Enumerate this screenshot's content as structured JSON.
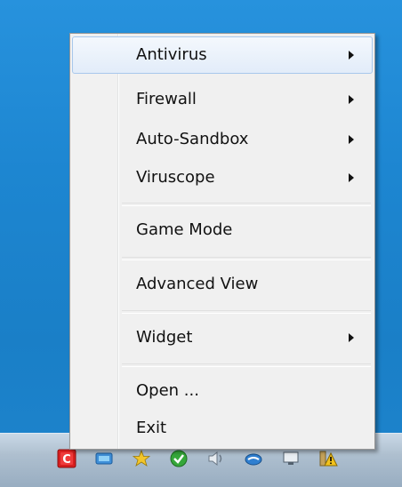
{
  "menu": {
    "items": [
      {
        "label": "Antivirus",
        "has_submenu": true,
        "highlighted": true
      },
      {
        "label": "Firewall",
        "has_submenu": true
      },
      {
        "label": "Auto-Sandbox",
        "has_submenu": true
      },
      {
        "label": "Viruscope",
        "has_submenu": true
      },
      {
        "label": "Game Mode",
        "has_submenu": false
      },
      {
        "label": "Advanced View",
        "has_submenu": false
      },
      {
        "label": "Widget",
        "has_submenu": true
      },
      {
        "label": "Open ...",
        "has_submenu": false
      },
      {
        "label": "Exit",
        "has_submenu": false
      }
    ]
  },
  "tray": {
    "icons": [
      "comodo-icon",
      "network-icon",
      "star-icon",
      "security-shield-icon",
      "volume-icon",
      "cloud-icon",
      "monitor-icon",
      "action-center-warning-icon"
    ]
  },
  "colors": {
    "desktop": "#1d86d1",
    "menu_bg": "#f0f0f0",
    "highlight_border": "#a8c8ec",
    "comodo_red": "#d81f1f"
  }
}
